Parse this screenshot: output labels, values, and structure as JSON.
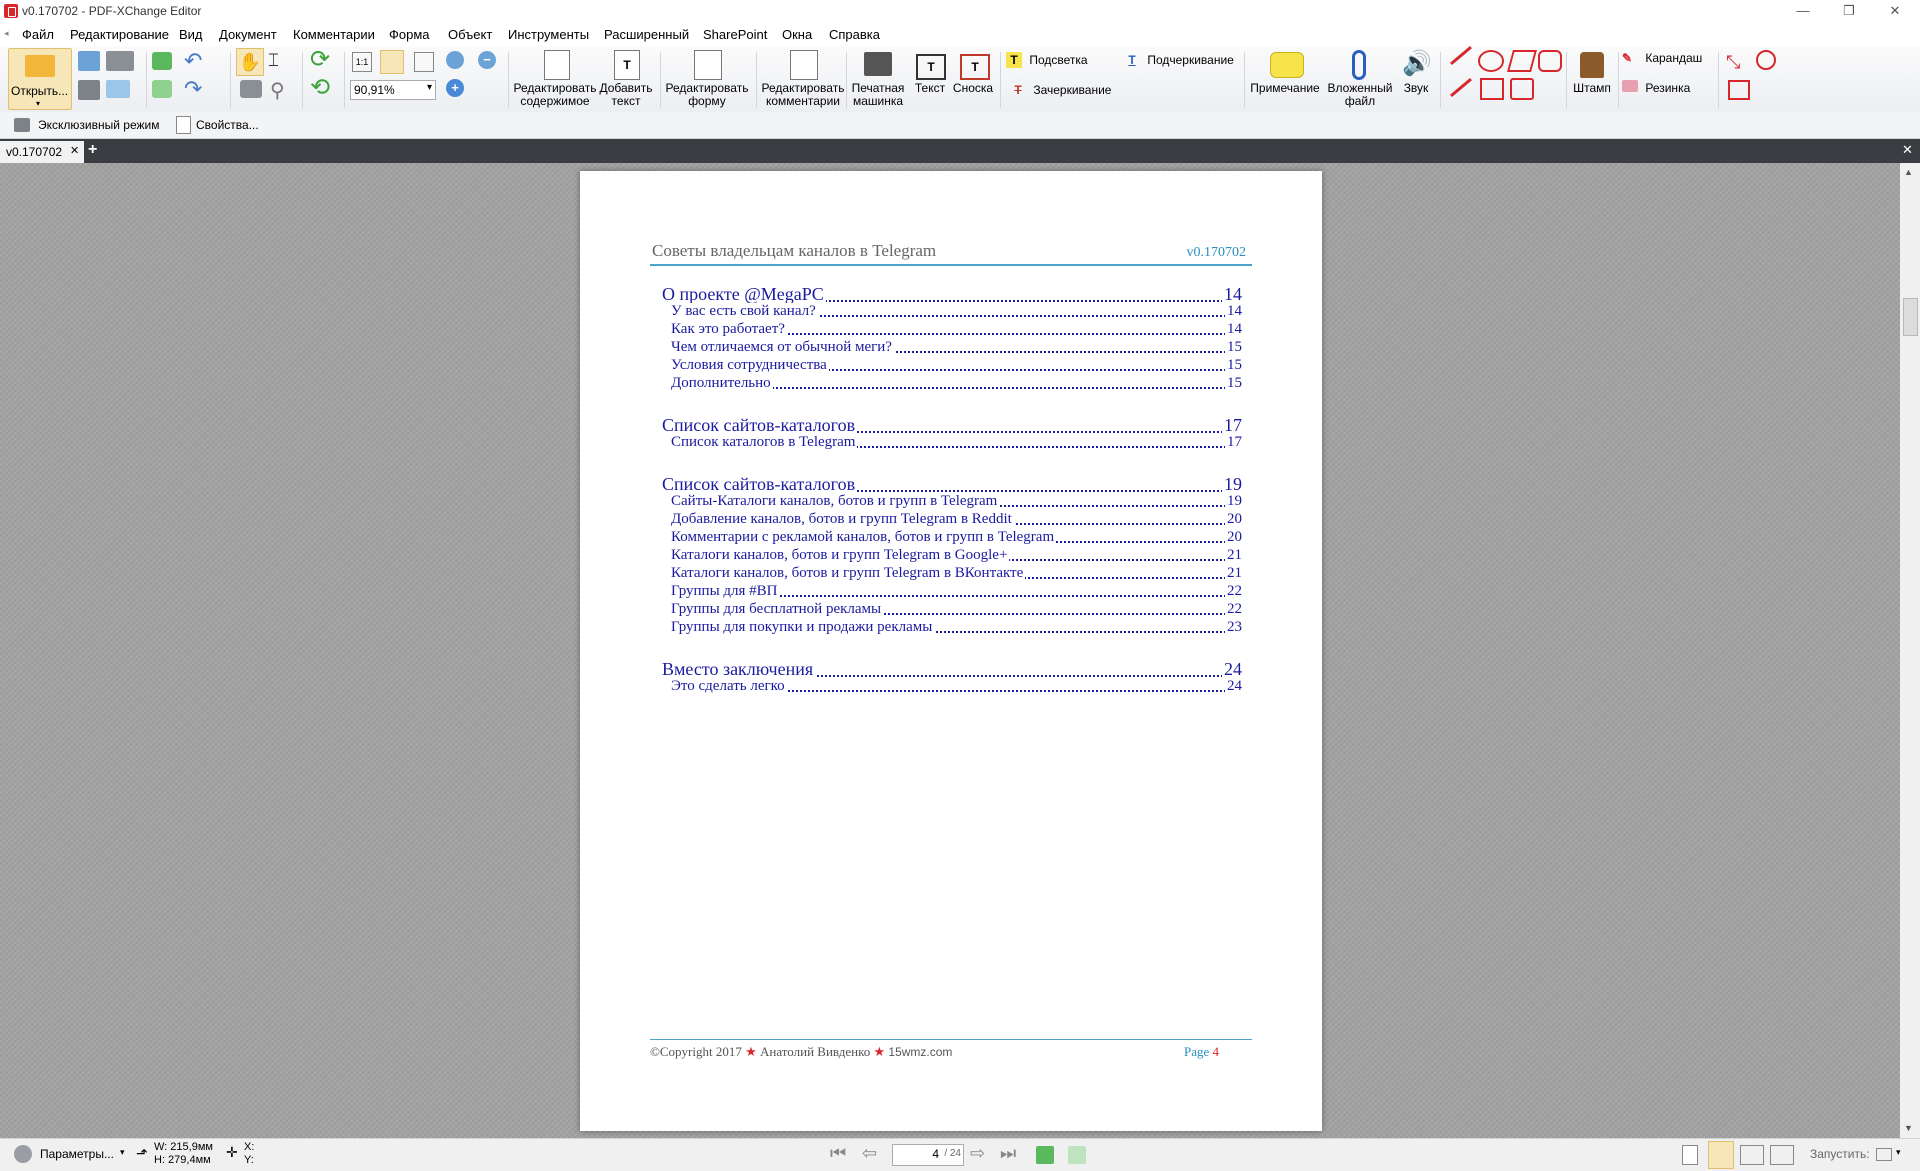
{
  "app": {
    "title": "v0.170702 - PDF-XChange Editor"
  },
  "menu": [
    "Файл",
    "Редактирование",
    "Вид",
    "Документ",
    "Комментарии",
    "Форма",
    "Объект",
    "Инструменты",
    "Расширенный",
    "SharePoint",
    "Окна",
    "Справка"
  ],
  "ribbon": {
    "open": "Открыть...",
    "zoom_value": "90,91%",
    "edit_content_1": "Редактировать",
    "edit_content_2": "содержимое",
    "add_text_1": "Добавить",
    "add_text_2": "текст",
    "edit_form_1": "Редактировать",
    "edit_form_2": "форму",
    "edit_comments_1": "Редактировать",
    "edit_comments_2": "комментарии",
    "typewriter_1": "Печатная",
    "typewriter_2": "машинка",
    "text": "Текст",
    "callout": "Сноска",
    "highlight": "Подсветка",
    "underline": "Подчеркивание",
    "strikeout": "Зачеркивание",
    "note": "Примечание",
    "attach_1": "Вложенный",
    "attach_2": "файл",
    "sound": "Звук",
    "stamp": "Штамп",
    "pencil": "Карандаш",
    "eraser": "Резинка",
    "exclusive_mode": "Эксклюзивный режим",
    "properties": "Свойства..."
  },
  "tab": {
    "label": "v0.170702"
  },
  "page": {
    "header_title": "Советы владельцам каналов в Telegram",
    "header_version": "v0.170702",
    "toc": [
      {
        "level": 1,
        "label": "О проекте @MegaPC",
        "page": "14"
      },
      {
        "level": 2,
        "label": "У вас есть свой канал?",
        "page": "14"
      },
      {
        "level": 2,
        "label": "Как это работает?",
        "page": "14"
      },
      {
        "level": 2,
        "label": "Чем отличаемся от обычной меги?",
        "page": "15"
      },
      {
        "level": 2,
        "label": "Условия сотрудничества",
        "page": "15"
      },
      {
        "level": 2,
        "label": "Дополнительно",
        "page": "15"
      },
      {
        "level": 1,
        "label": "Список сайтов-каталогов",
        "page": "17"
      },
      {
        "level": 2,
        "label": "Список каталогов в Telegram",
        "page": "17"
      },
      {
        "level": 1,
        "label": "Список сайтов-каталогов",
        "page": "19"
      },
      {
        "level": 2,
        "label": "Сайты-Каталоги каналов, ботов и групп в Telegram",
        "page": "19"
      },
      {
        "level": 2,
        "label": "Добавление каналов, ботов и групп Telegram в Reddit",
        "page": "20"
      },
      {
        "level": 2,
        "label": "Комментарии с рекламой каналов, ботов и групп в Telegram",
        "page": "20"
      },
      {
        "level": 2,
        "label": "Каталоги каналов, ботов и групп Telegram в Google+",
        "page": "21"
      },
      {
        "level": 2,
        "label": "Каталоги каналов, ботов и групп Telegram в ВКонтакте",
        "page": "21"
      },
      {
        "level": 2,
        "label": "Группы для #ВП",
        "page": "22"
      },
      {
        "level": 2,
        "label": "Группы для бесплатной рекламы",
        "page": "22"
      },
      {
        "level": 2,
        "label": "Группы для покупки и продажи рекламы",
        "page": "23"
      },
      {
        "level": 1,
        "label": "Вместо заключения",
        "page": "24"
      },
      {
        "level": 2,
        "label": "Это сделать легко",
        "page": "24"
      }
    ],
    "footer_copyright": "©Copyright 2017",
    "footer_author": "Анатолий Вивденко",
    "footer_site": "15wmz.com",
    "footer_page_label": "Page",
    "footer_page_num": "4"
  },
  "status": {
    "params": "Параметры...",
    "width": "W: 215,9мм",
    "height": "H: 279,4мм",
    "x": "X:",
    "y": "Y:",
    "page_current": "4",
    "page_total": "/ 24",
    "launch": "Запустить:"
  },
  "colors": {
    "accent": "#1a1aa0",
    "header_line": "#4aa3c8",
    "version": "#2a8fc0",
    "star": "#d8262d"
  }
}
